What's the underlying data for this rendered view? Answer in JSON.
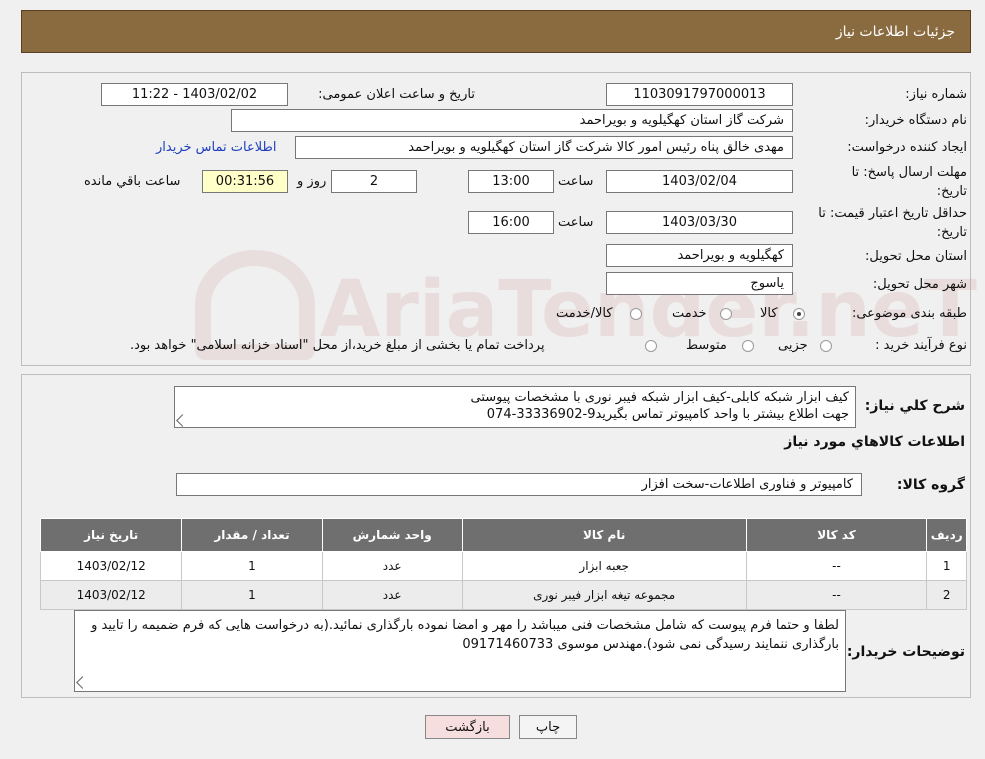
{
  "header": {
    "title": "جزئیات اطلاعات نیاز"
  },
  "fields": {
    "need_number_label": "شماره نیاز:",
    "need_number": "1103091797000013",
    "announce_label": "تاریخ و ساعت اعلان عمومی:",
    "announce_value": "1403/02/02 - 11:22",
    "buyer_org_label": "نام دستگاه خریدار:",
    "buyer_org": "شرکت گاز استان کهگیلویه و بویراحمد",
    "creator_label": "ایجاد کننده درخواست:",
    "creator": "مهدی خالق پناه رئیس امور کالا شرکت گاز استان کهگیلویه و بویراحمد",
    "contact_link": "اطلاعات تماس خریدار",
    "deadline_label_1": "مهلت ارسال پاسخ: تا",
    "deadline_label_2": "تاریخ:",
    "deadline_date": "1403/02/04",
    "time_word": "ساعت",
    "deadline_time": "13:00",
    "days": "2",
    "days_word": "روز و",
    "remaining_time": "00:31:56",
    "remaining_word": "ساعت باقي مانده",
    "price_valid_label_1": "حداقل تاریخ اعتبار قیمت: تا",
    "price_valid_label_2": "تاریخ:",
    "price_valid_date": "1403/03/30",
    "price_valid_time": "16:00",
    "province_label": "استان محل تحویل:",
    "province": "کهگیلویه و بویراحمد",
    "city_label": "شهر محل تحویل:",
    "city": "یاسوج",
    "category_label": "طبقه بندی موضوعی:",
    "category_options": [
      "کالا",
      "خدمت",
      "کالا/خدمت"
    ],
    "category_selected": "کالا",
    "process_label": "نوع فرآیند خرید :",
    "process_options": [
      "جزیی",
      "متوسط"
    ],
    "process_note": "پرداخت تمام یا بخشی از مبلغ خرید،از محل \"اسناد خزانه اسلامی\" خواهد بود."
  },
  "summary": {
    "label": "شرح کلي نياز:",
    "line1": "کیف ابزار شبکه کابلی-کیف ابزار شبکه فیبر نوری با مشخصات پیوستی",
    "line2": "جهت اطلاع بیشتر با واحد کامپیوتر تماس بگیرید9-33336902-074"
  },
  "goods": {
    "title": "اطلاعات کالاهاي مورد نياز",
    "group_label": "گروه کالا:",
    "group_value": "کامپیوتر و فناوری اطلاعات-سخت افزار"
  },
  "table": {
    "headers": [
      "رديف",
      "کد کالا",
      "نام کالا",
      "واحد شمارش",
      "تعداد / مقدار",
      "تاريخ نياز"
    ],
    "rows": [
      [
        "1",
        "--",
        "جعبه ابزار",
        "عدد",
        "1",
        "1403/02/12"
      ],
      [
        "2",
        "--",
        "مجموعه تیغه ابزار فیبر نوری",
        "عدد",
        "1",
        "1403/02/12"
      ]
    ]
  },
  "notes": {
    "label": "توضيحات خريدار:",
    "text": "لطفا و حتما فرم پیوست که شامل مشخصات فنی میباشد را مهر و امضا نموده بارگذاری نمائید.(به درخواست هایی که فرم ضمیمه را تایید و بارگذاری ننمایند رسیدگی نمی شود).مهندس موسوی 09171460733"
  },
  "buttons": {
    "print": "چاپ",
    "back": "بازگشت"
  },
  "watermark": "AriaTender.neT",
  "colors": {
    "header_bg": "#8a6a3f",
    "table_header": "#6f6f6f",
    "back_button": "#f7dede",
    "link": "#1d3fbf"
  }
}
